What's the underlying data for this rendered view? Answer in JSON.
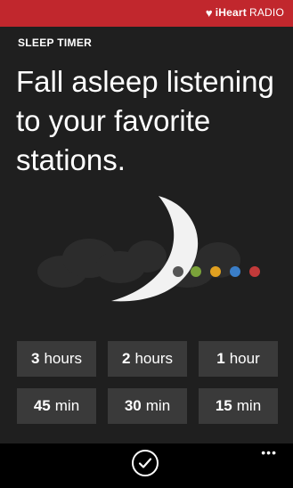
{
  "header": {
    "brand_icon": "iheart-heart-logo",
    "brand_bold": "iHeart",
    "brand_light": "RADIO",
    "color": "#c1272d"
  },
  "page": {
    "section_title": "SLEEP TIMER",
    "headline": "Fall asleep listening to your favorite stations."
  },
  "illustration": {
    "icon": "moon-and-clouds",
    "dot_colors": [
      "#555555",
      "#7aa23a",
      "#e0a020",
      "#3a7ec8",
      "#c23a3a"
    ]
  },
  "timers": [
    {
      "num": "3",
      "unit": "hours"
    },
    {
      "num": "2",
      "unit": "hours"
    },
    {
      "num": "1",
      "unit": "hour"
    },
    {
      "num": "45",
      "unit": "min"
    },
    {
      "num": "30",
      "unit": "min"
    },
    {
      "num": "15",
      "unit": "min"
    }
  ],
  "appbar": {
    "confirm_icon": "check-circle-icon",
    "more_label": "•••"
  }
}
